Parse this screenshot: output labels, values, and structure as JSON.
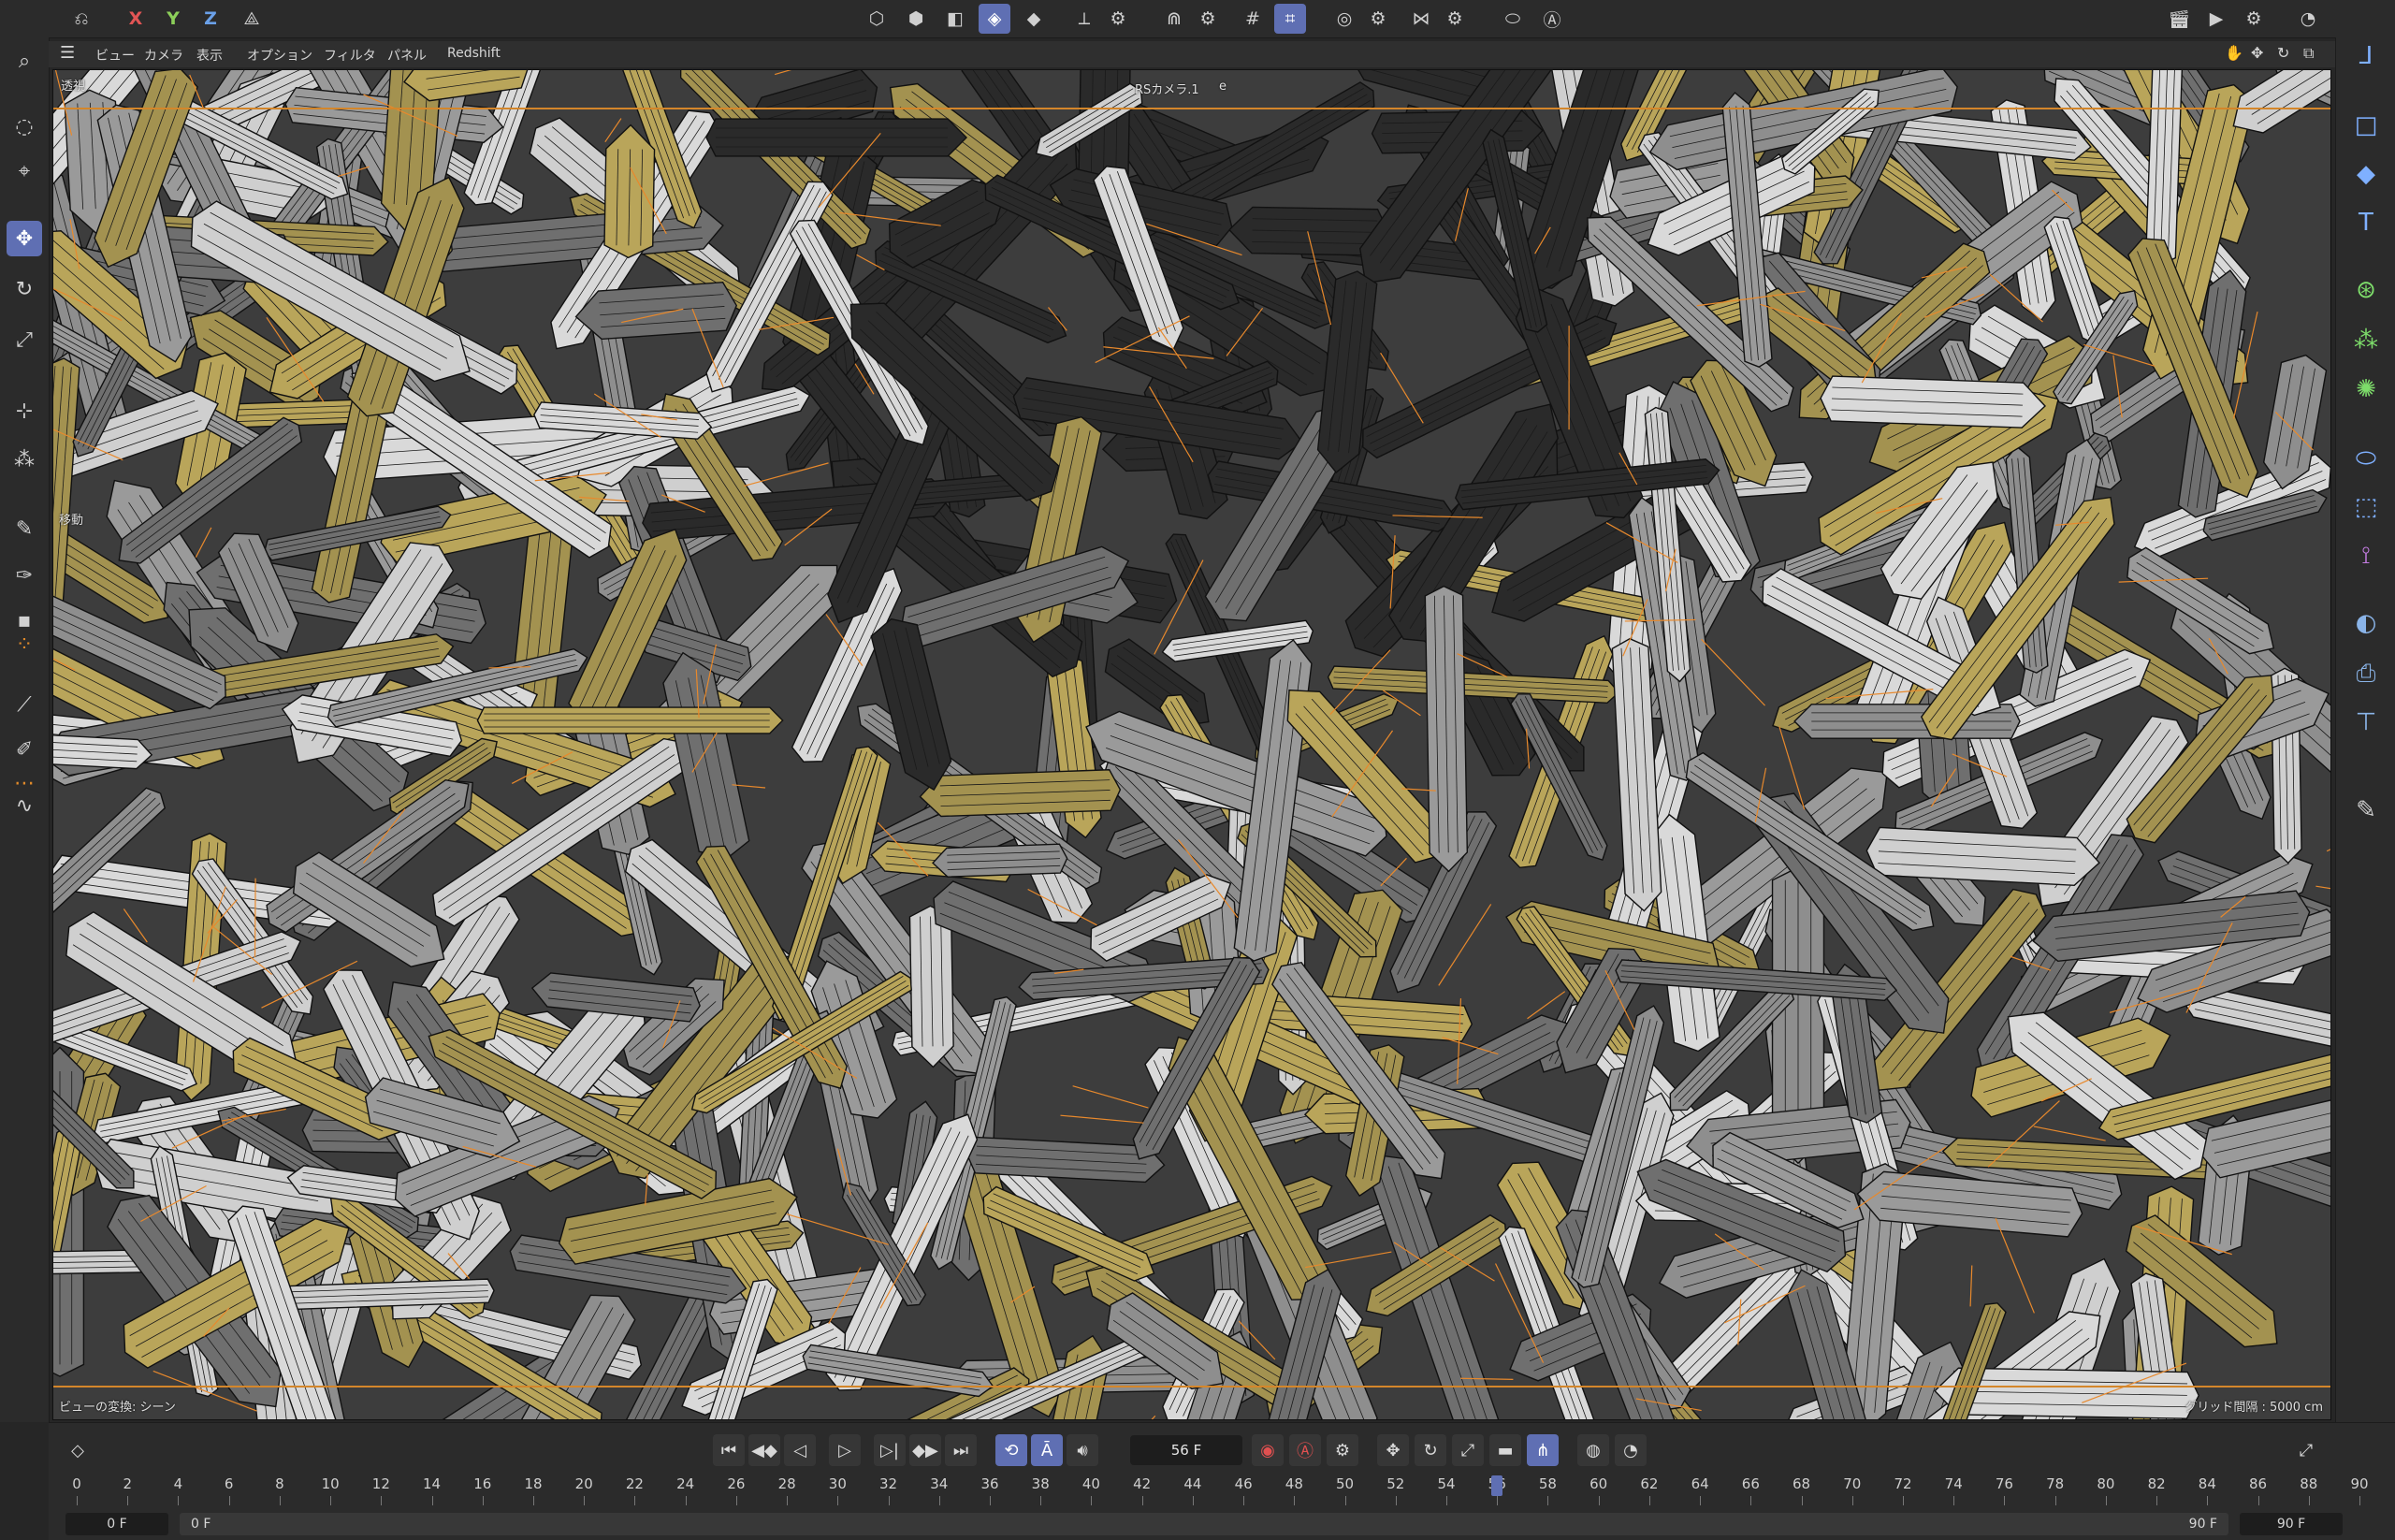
{
  "top_toolbar": {
    "axis_x": "X",
    "axis_y": "Y",
    "axis_z": "Z",
    "icons": [
      "undo-icon",
      "axis-lock-icon",
      "point-mode-icon",
      "edge-mode-icon",
      "polygon-mode-icon",
      "model-mode-icon",
      "texture-mode-icon",
      "workplane-icon",
      "snap-icon",
      "grid-icon",
      "quantize-icon",
      "solo-icon",
      "symmetry-icon",
      "vr-icon",
      "render-view-icon",
      "render-icon",
      "render-settings-icon",
      "history-icon"
    ]
  },
  "viewport_menu": {
    "items": [
      "ビュー",
      "カメラ",
      "表示",
      "オプション",
      "フィルタ",
      "パネル",
      "Redshift"
    ]
  },
  "viewport": {
    "camera_label": "RSカメラ.1",
    "camera_marker": "e",
    "projection_label": "透視",
    "bottom_left_label": "ビューの変換: シーン",
    "grid_spacing_label": "グリッド間隔 : 5000 cm",
    "side_label": "移動"
  },
  "timeline": {
    "current_frame": "56 F",
    "ruler_labels": [
      "0",
      "2",
      "4",
      "6",
      "8",
      "10",
      "12",
      "14",
      "16",
      "18",
      "20",
      "22",
      "24",
      "26",
      "28",
      "30",
      "32",
      "34",
      "36",
      "38",
      "40",
      "42",
      "44",
      "46",
      "48",
      "50",
      "52",
      "54",
      "56",
      "58",
      "60",
      "62",
      "64",
      "66",
      "68",
      "70",
      "72",
      "74",
      "76",
      "78",
      "80",
      "82",
      "84",
      "86",
      "88",
      "90"
    ],
    "playhead_frame": 56,
    "max_frame": 90,
    "range_start": "0 F",
    "range_preview_start": "0 F",
    "range_preview_end": "90 F",
    "range_end": "90 F"
  },
  "colors": {
    "accent": "#5f6fb3",
    "safe_frame": "#d4862a",
    "shard_gold": "#b9a55a",
    "shard_grey": "#9a9a9a"
  }
}
